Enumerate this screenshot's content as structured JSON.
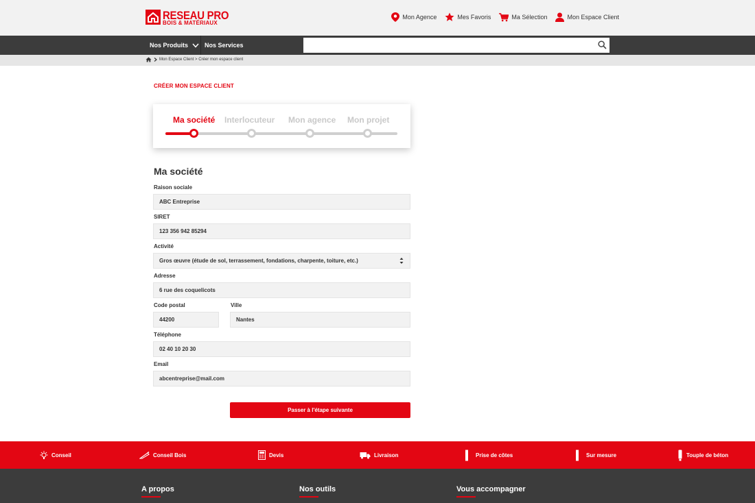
{
  "colors": {
    "brand": "#e30613",
    "dark": "#3c3c3c",
    "field_bg": "#f2f2f2"
  },
  "logo": {
    "main": "RESEAU PRO",
    "sub": "BOIS & MATÉRIAUX"
  },
  "header_links": [
    {
      "label": "Mon Agence",
      "icon": "location-pin-icon"
    },
    {
      "label": "Mes Favoris",
      "icon": "star-icon"
    },
    {
      "label": "Ma Sélection",
      "icon": "cart-icon"
    },
    {
      "label": "Mon Espace Client",
      "icon": "user-icon"
    }
  ],
  "nav": {
    "produits": "Nos Produits",
    "services": "Nos Services",
    "search_placeholder": ""
  },
  "breadcrumb": {
    "text": "Mon Espace Client > Créer mon espace client"
  },
  "page_title": "CRÉER MON ESPACE CLIENT",
  "stepper": {
    "steps": [
      "Ma société",
      "Interlocuteur",
      "Mon agence",
      "Mon projet"
    ],
    "current_step": 1
  },
  "form": {
    "section_title": "Ma société",
    "raison_sociale": {
      "label": "Raison sociale",
      "value": "ABC Entreprise"
    },
    "siret": {
      "label": "SIRET",
      "value": "123 356 942 85294"
    },
    "activite": {
      "label": "Activité",
      "value": "Gros œuvre (étude de sol, terrassement, fondations, charpente, toiture, etc.)"
    },
    "adresse": {
      "label": "Adresse",
      "value": "6 rue des coquelicots"
    },
    "code_postal": {
      "label": "Code postal",
      "value": "44200"
    },
    "ville": {
      "label": "Ville",
      "value": "Nantes"
    },
    "telephone": {
      "label": "Téléphone",
      "value": "02 40 10 20 30"
    },
    "email": {
      "label": "Email",
      "value": "abcentreprise@mail.com"
    },
    "submit": "Passer à l'étape suivante"
  },
  "services_band": [
    {
      "label": "Conseil",
      "icon": "lightbulb-icon"
    },
    {
      "label": "Conseil Bois",
      "icon": "saw-icon"
    },
    {
      "label": "Devis",
      "icon": "calculator-icon"
    },
    {
      "label": "Livraison",
      "icon": "truck-icon"
    },
    {
      "label": "Prise de côtes",
      "icon": "ruler-icon"
    },
    {
      "label": "Sur mesure",
      "icon": "ruler-icon"
    },
    {
      "label": "Touple de béton",
      "icon": "mixer-icon"
    }
  ],
  "footer": {
    "cols": [
      "A propos",
      "Nos outils",
      "Vous accompagner"
    ]
  }
}
